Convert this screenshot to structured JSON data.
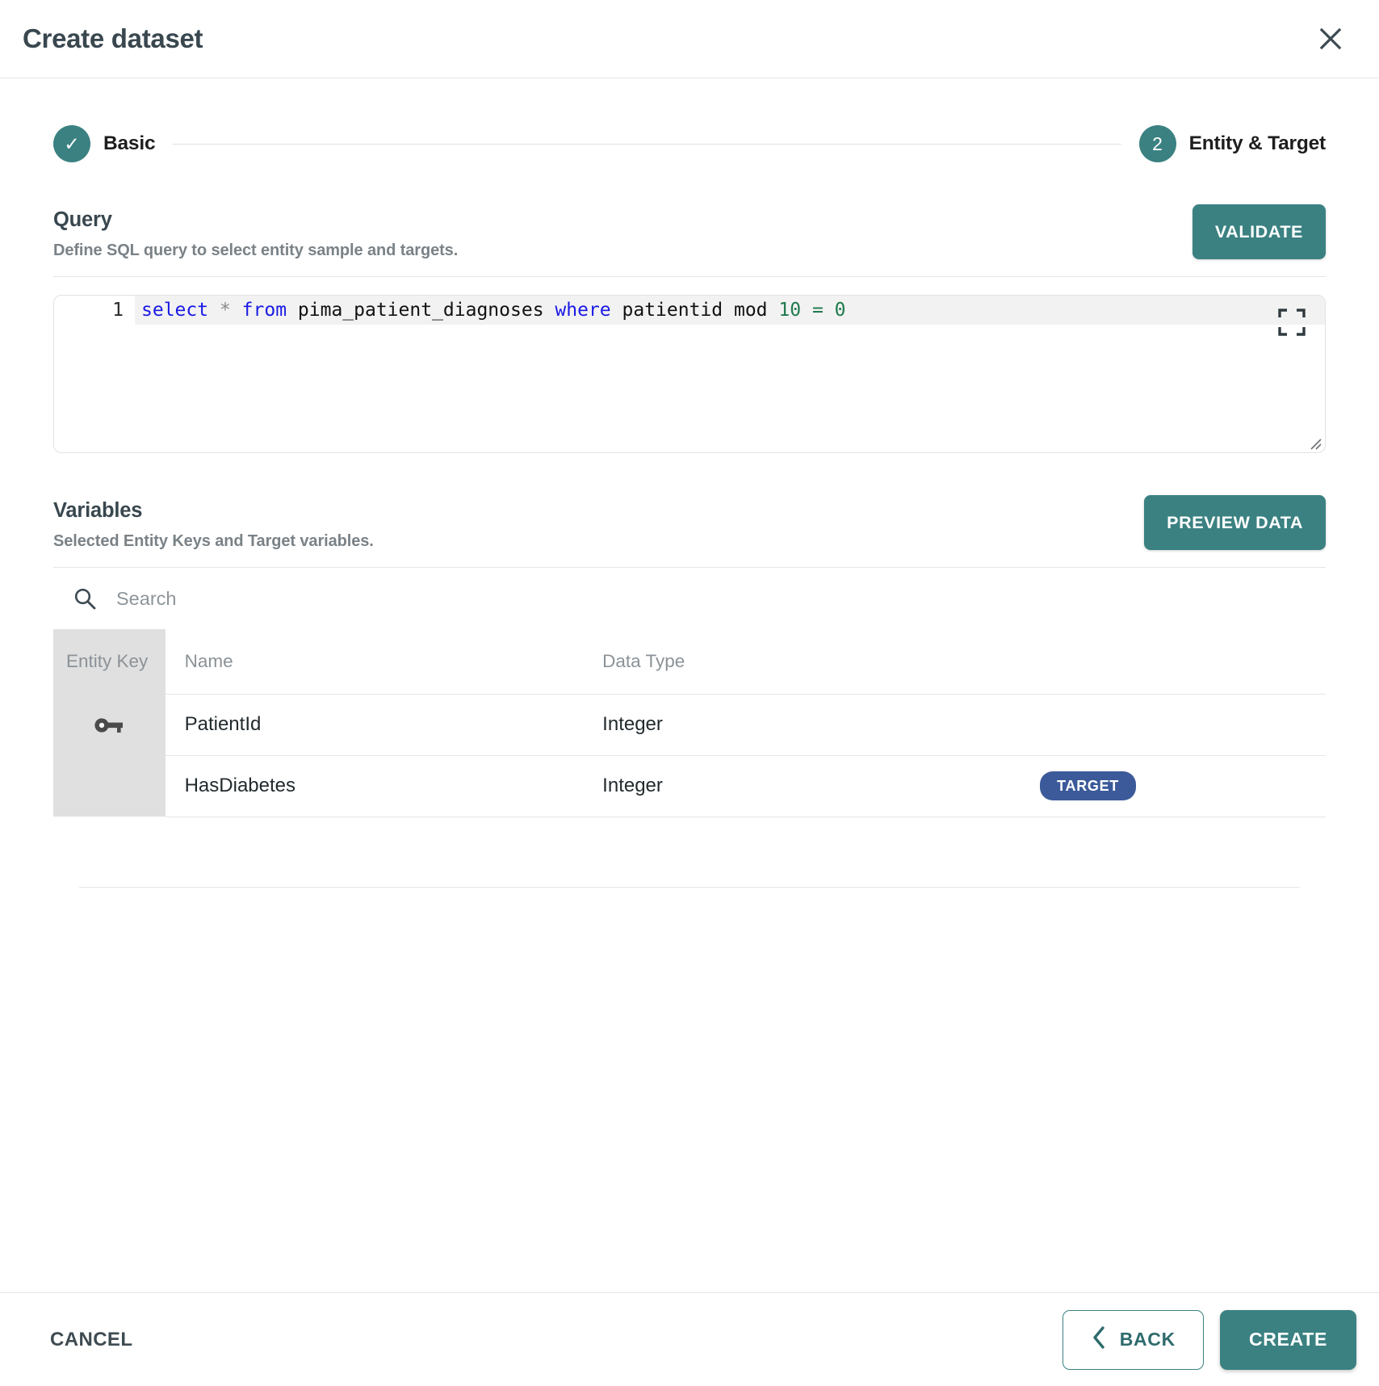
{
  "dialog": {
    "title": "Create dataset",
    "close_icon": "close-icon"
  },
  "stepper": {
    "steps": [
      {
        "label": "Basic",
        "indicator": "✓",
        "state": "completed"
      },
      {
        "label": "Entity & Target",
        "indicator": "2",
        "state": "active"
      }
    ]
  },
  "query": {
    "title": "Query",
    "subtitle": "Define SQL query to select entity sample and targets.",
    "validate_label": "VALIDATE",
    "line_number": "1",
    "sql_tokens": [
      {
        "text": "select",
        "type": "keyword"
      },
      {
        "text": " ",
        "type": "plain"
      },
      {
        "text": "*",
        "type": "operator"
      },
      {
        "text": " ",
        "type": "plain"
      },
      {
        "text": "from",
        "type": "keyword"
      },
      {
        "text": " pima_patient_diagnoses ",
        "type": "plain"
      },
      {
        "text": "where",
        "type": "keyword"
      },
      {
        "text": " patientid mod ",
        "type": "plain"
      },
      {
        "text": "10",
        "type": "number"
      },
      {
        "text": " ",
        "type": "plain"
      },
      {
        "text": "=",
        "type": "number"
      },
      {
        "text": " ",
        "type": "plain"
      },
      {
        "text": "0",
        "type": "number"
      }
    ],
    "sql_text": "select * from pima_patient_diagnoses where patientid mod 10 = 0",
    "expand_icon": "expand-icon",
    "resize_icon": "resize-handle-icon"
  },
  "variables": {
    "title": "Variables",
    "subtitle": "Selected Entity Keys and Target variables.",
    "preview_label": "PREVIEW DATA",
    "search_placeholder": "Search",
    "search_value": "",
    "search_icon": "search-icon",
    "columns": [
      "Entity Key",
      "Name",
      "Data Type",
      ""
    ],
    "rows": [
      {
        "entity_key": true,
        "key_icon": "key-icon",
        "name": "PatientId",
        "data_type": "Integer",
        "tag": ""
      },
      {
        "entity_key": false,
        "key_icon": "",
        "name": "HasDiabetes",
        "data_type": "Integer",
        "tag": "TARGET"
      }
    ]
  },
  "footer": {
    "cancel_label": "CANCEL",
    "back_label": "BACK",
    "back_icon": "chevron-left-icon",
    "create_label": "CREATE"
  },
  "colors": {
    "accent_teal": "#3b8182",
    "target_blue": "#3c5a9a",
    "title_slate": "#39474f",
    "muted_gray": "#8b9297",
    "row_key_bg": "#e0e0e0",
    "divider": "#e4e6e8",
    "sql_keyword": "#1a1ae6",
    "sql_number": "#1f7a4d"
  }
}
